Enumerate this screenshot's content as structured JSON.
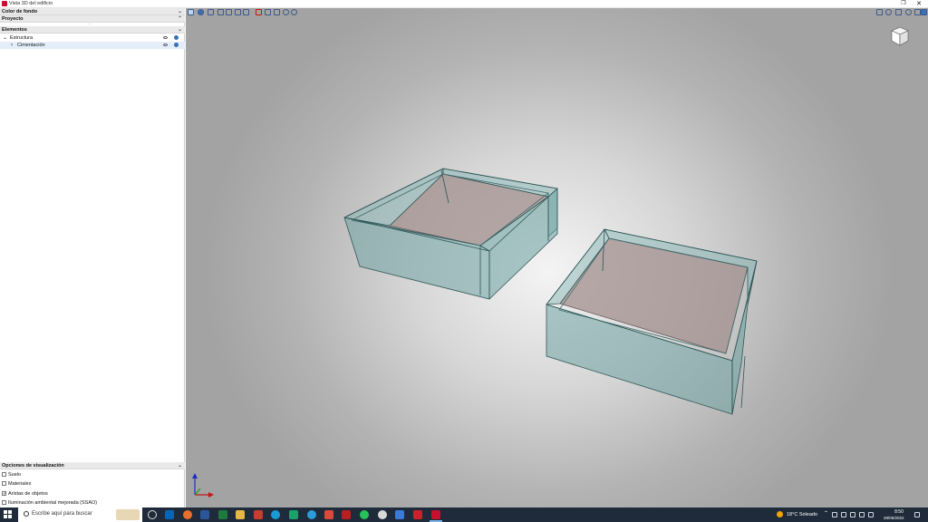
{
  "window": {
    "title": "Vista 3D del edificio",
    "restore_icon": "restore-icon",
    "close_icon": "close-icon"
  },
  "left_panel": {
    "background_color_label": "Color de fondo",
    "project_label": "Proyecto",
    "elements_label": "Elementos",
    "tree": [
      {
        "label": "Estructura",
        "expanded": true
      },
      {
        "label": "Cimentación",
        "expanded": false,
        "selected": true
      }
    ],
    "display_options_label": "Opciones de visualización",
    "options": [
      {
        "label": "Suelo",
        "checked": false
      },
      {
        "label": "Materiales",
        "checked": false
      },
      {
        "label": "Aristas de objetos",
        "checked": true
      },
      {
        "label": "Iluminación ambiental mejorada (SSAO)",
        "checked": false
      }
    ]
  },
  "toolbar": {
    "icons": [
      "select-icon",
      "info-icon",
      "axes-icon",
      "shield-icon",
      "clip-icon",
      "layers-icon",
      "material-icon",
      "grid-icon",
      "measure-icon",
      "settings-icon",
      "eye-icon"
    ],
    "right_icons": [
      "zoom-fit-icon",
      "zoom-icon",
      "pan-icon",
      "orbit-icon",
      "home-icon",
      "perspective-icon"
    ]
  },
  "taskbar": {
    "search_placeholder": "Escribe aquí para buscar",
    "weather": "18°C  Soleado",
    "time": "8:50",
    "date": "28/06/2022",
    "apps": [
      "task-view-icon",
      "outlook-icon",
      "firefox-icon",
      "word-icon",
      "excel-icon",
      "files-icon",
      "app-red-icon",
      "skype-icon",
      "edge-icon",
      "chrome-icon",
      "acrobat-icon",
      "app-acrobat-icon",
      "whatsapp-icon",
      "app-blue-icon",
      "app-pink-icon",
      "app-cype-icon",
      "app-cype-active-icon"
    ]
  },
  "colors": {
    "accent": "#3b6fb6",
    "taskbar": "#1f2b3a",
    "box_fill": "#5f9ea0"
  }
}
